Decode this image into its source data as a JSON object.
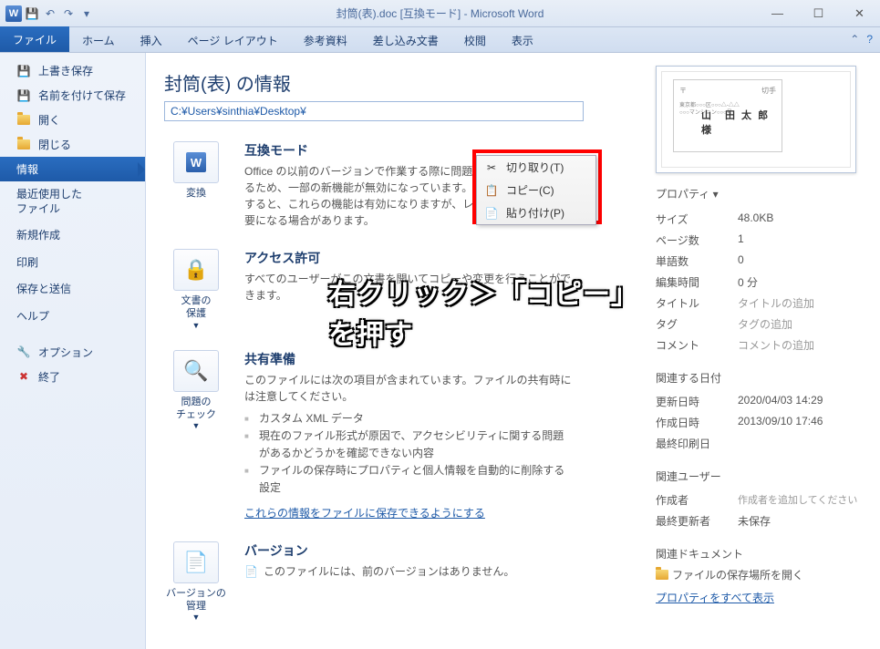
{
  "title": "封筒(表).doc [互換モード] - Microsoft Word",
  "ribbon": {
    "file": "ファイル",
    "tabs": [
      "ホーム",
      "挿入",
      "ページ レイアウト",
      "参考資料",
      "差し込み文書",
      "校閲",
      "表示"
    ]
  },
  "sidebar": {
    "save_overwrite": "上書き保存",
    "save_as": "名前を付けて保存",
    "open": "開く",
    "close": "閉じる",
    "info": "情報",
    "recent": "最近使用した\nファイル",
    "new": "新規作成",
    "print": "印刷",
    "save_send": "保存と送信",
    "help": "ヘルプ",
    "options": "オプション",
    "exit": "終了"
  },
  "main": {
    "heading": "封筒(表) の情報",
    "path": "C:¥Users¥sinthia¥Desktop¥",
    "compat": {
      "title": "互換モード",
      "body": "Office の以前のバージョンで作業する際に問題が起きないようにするため、一部の新機能が無効になっています。このファイルを変換すると、これらの機能は有効になりますが、レイアウトの変更が必要になる場合があります。",
      "btn": "変換"
    },
    "permissions": {
      "title": "アクセス許可",
      "body": "すべてのユーザーがこの文書を開いてコピーや変更を行うことができます。",
      "btn": "文書の\n保護"
    },
    "share": {
      "title": "共有準備",
      "body": "このファイルには次の項目が含まれています。ファイルの共有時には注意してください。",
      "items": [
        "カスタム XML データ",
        "現在のファイル形式が原因で、アクセシビリティに関する問題があるかどうかを確認できない内容",
        "ファイルの保存時にプロパティと個人情報を自動的に削除する設定"
      ],
      "link": "これらの情報をファイルに保存できるようにする",
      "btn": "問題の\nチェック"
    },
    "versions": {
      "title": "バージョン",
      "body": "このファイルには、前のバージョンはありません。",
      "btn": "バージョンの\n管理"
    }
  },
  "ctx": {
    "cut": "切り取り(T)",
    "copy": "コピー(C)",
    "paste": "貼り付け(P)"
  },
  "overlay": "右クリック＞「コピー」を押す",
  "props": {
    "head": "プロパティ",
    "size_k": "サイズ",
    "size_v": "48.0KB",
    "pages_k": "ページ数",
    "pages_v": "1",
    "words_k": "単語数",
    "words_v": "0",
    "edit_k": "編集時間",
    "edit_v": "0 分",
    "title_k": "タイトル",
    "title_v": "タイトルの追加",
    "tag_k": "タグ",
    "tag_v": "タグの追加",
    "comment_k": "コメント",
    "comment_v": "コメントの追加",
    "dates_head": "関連する日付",
    "updated_k": "更新日時",
    "updated_v": "2020/04/03 14:29",
    "created_k": "作成日時",
    "created_v": "2013/09/10 17:46",
    "printed_k": "最終印刷日",
    "users_head": "関連ユーザー",
    "author_k": "作成者",
    "author_v": "作成者を追加してください",
    "lastmod_k": "最終更新者",
    "lastmod_v": "未保存",
    "docs_head": "関連ドキュメント",
    "open_loc": "ファイルの保存場所を開く",
    "show_all": "プロパティをすべて表示"
  },
  "thumb": {
    "name": "山　田 太 郎 様"
  }
}
